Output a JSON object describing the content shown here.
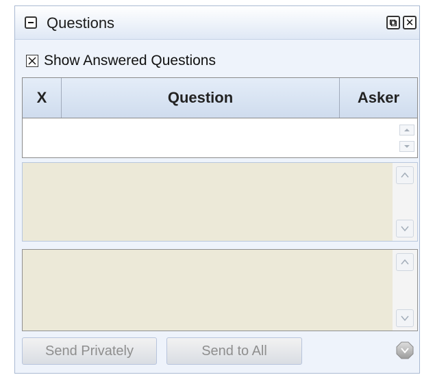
{
  "panel": {
    "title": "Questions",
    "popout_glyph": "⧉",
    "close_glyph": "✕"
  },
  "filter": {
    "show_answered_label": "Show Answered Questions",
    "show_answered_checked": true
  },
  "table": {
    "columns": [
      "X",
      "Question",
      "Asker"
    ],
    "rows": []
  },
  "answer_area": {
    "value": ""
  },
  "compose_area": {
    "value": ""
  },
  "actions": {
    "send_privately_label": "Send Privately",
    "send_to_all_label": "Send to All"
  },
  "icons": [
    "collapse-icon",
    "popout-icon",
    "close-icon",
    "checkbox-x-icon",
    "chevron-up-icon",
    "chevron-down-icon",
    "send-gem-icon"
  ],
  "colors": {
    "panel_background": "#eef3fb",
    "text_area_background": "#ece9d8",
    "header_gradient_top": "#e4edf8",
    "header_gradient_bottom": "#cfdcee",
    "disabled_text": "#8e8e8e"
  }
}
